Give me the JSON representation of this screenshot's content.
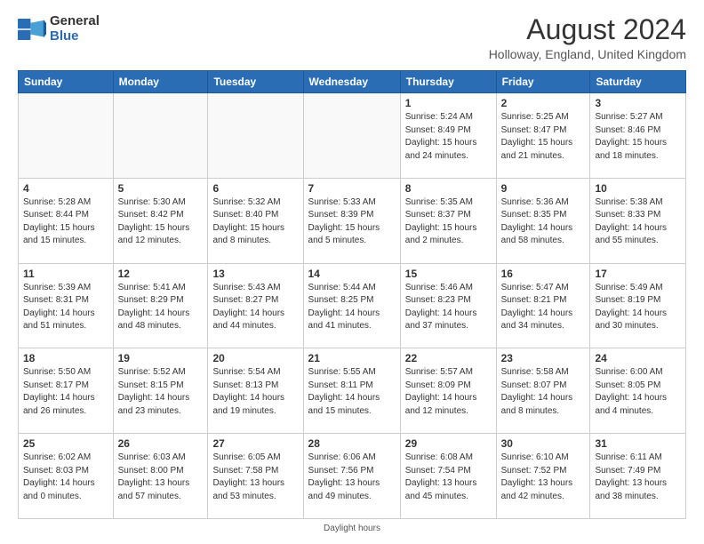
{
  "header": {
    "logo_line1": "General",
    "logo_line2": "Blue",
    "main_title": "August 2024",
    "subtitle": "Holloway, England, United Kingdom"
  },
  "calendar": {
    "columns": [
      "Sunday",
      "Monday",
      "Tuesday",
      "Wednesday",
      "Thursday",
      "Friday",
      "Saturday"
    ],
    "weeks": [
      {
        "days": [
          {
            "num": "",
            "info": ""
          },
          {
            "num": "",
            "info": ""
          },
          {
            "num": "",
            "info": ""
          },
          {
            "num": "",
            "info": ""
          },
          {
            "num": "1",
            "info": "Sunrise: 5:24 AM\nSunset: 8:49 PM\nDaylight: 15 hours\nand 24 minutes."
          },
          {
            "num": "2",
            "info": "Sunrise: 5:25 AM\nSunset: 8:47 PM\nDaylight: 15 hours\nand 21 minutes."
          },
          {
            "num": "3",
            "info": "Sunrise: 5:27 AM\nSunset: 8:46 PM\nDaylight: 15 hours\nand 18 minutes."
          }
        ]
      },
      {
        "days": [
          {
            "num": "4",
            "info": "Sunrise: 5:28 AM\nSunset: 8:44 PM\nDaylight: 15 hours\nand 15 minutes."
          },
          {
            "num": "5",
            "info": "Sunrise: 5:30 AM\nSunset: 8:42 PM\nDaylight: 15 hours\nand 12 minutes."
          },
          {
            "num": "6",
            "info": "Sunrise: 5:32 AM\nSunset: 8:40 PM\nDaylight: 15 hours\nand 8 minutes."
          },
          {
            "num": "7",
            "info": "Sunrise: 5:33 AM\nSunset: 8:39 PM\nDaylight: 15 hours\nand 5 minutes."
          },
          {
            "num": "8",
            "info": "Sunrise: 5:35 AM\nSunset: 8:37 PM\nDaylight: 15 hours\nand 2 minutes."
          },
          {
            "num": "9",
            "info": "Sunrise: 5:36 AM\nSunset: 8:35 PM\nDaylight: 14 hours\nand 58 minutes."
          },
          {
            "num": "10",
            "info": "Sunrise: 5:38 AM\nSunset: 8:33 PM\nDaylight: 14 hours\nand 55 minutes."
          }
        ]
      },
      {
        "days": [
          {
            "num": "11",
            "info": "Sunrise: 5:39 AM\nSunset: 8:31 PM\nDaylight: 14 hours\nand 51 minutes."
          },
          {
            "num": "12",
            "info": "Sunrise: 5:41 AM\nSunset: 8:29 PM\nDaylight: 14 hours\nand 48 minutes."
          },
          {
            "num": "13",
            "info": "Sunrise: 5:43 AM\nSunset: 8:27 PM\nDaylight: 14 hours\nand 44 minutes."
          },
          {
            "num": "14",
            "info": "Sunrise: 5:44 AM\nSunset: 8:25 PM\nDaylight: 14 hours\nand 41 minutes."
          },
          {
            "num": "15",
            "info": "Sunrise: 5:46 AM\nSunset: 8:23 PM\nDaylight: 14 hours\nand 37 minutes."
          },
          {
            "num": "16",
            "info": "Sunrise: 5:47 AM\nSunset: 8:21 PM\nDaylight: 14 hours\nand 34 minutes."
          },
          {
            "num": "17",
            "info": "Sunrise: 5:49 AM\nSunset: 8:19 PM\nDaylight: 14 hours\nand 30 minutes."
          }
        ]
      },
      {
        "days": [
          {
            "num": "18",
            "info": "Sunrise: 5:50 AM\nSunset: 8:17 PM\nDaylight: 14 hours\nand 26 minutes."
          },
          {
            "num": "19",
            "info": "Sunrise: 5:52 AM\nSunset: 8:15 PM\nDaylight: 14 hours\nand 23 minutes."
          },
          {
            "num": "20",
            "info": "Sunrise: 5:54 AM\nSunset: 8:13 PM\nDaylight: 14 hours\nand 19 minutes."
          },
          {
            "num": "21",
            "info": "Sunrise: 5:55 AM\nSunset: 8:11 PM\nDaylight: 14 hours\nand 15 minutes."
          },
          {
            "num": "22",
            "info": "Sunrise: 5:57 AM\nSunset: 8:09 PM\nDaylight: 14 hours\nand 12 minutes."
          },
          {
            "num": "23",
            "info": "Sunrise: 5:58 AM\nSunset: 8:07 PM\nDaylight: 14 hours\nand 8 minutes."
          },
          {
            "num": "24",
            "info": "Sunrise: 6:00 AM\nSunset: 8:05 PM\nDaylight: 14 hours\nand 4 minutes."
          }
        ]
      },
      {
        "days": [
          {
            "num": "25",
            "info": "Sunrise: 6:02 AM\nSunset: 8:03 PM\nDaylight: 14 hours\nand 0 minutes."
          },
          {
            "num": "26",
            "info": "Sunrise: 6:03 AM\nSunset: 8:00 PM\nDaylight: 13 hours\nand 57 minutes."
          },
          {
            "num": "27",
            "info": "Sunrise: 6:05 AM\nSunset: 7:58 PM\nDaylight: 13 hours\nand 53 minutes."
          },
          {
            "num": "28",
            "info": "Sunrise: 6:06 AM\nSunset: 7:56 PM\nDaylight: 13 hours\nand 49 minutes."
          },
          {
            "num": "29",
            "info": "Sunrise: 6:08 AM\nSunset: 7:54 PM\nDaylight: 13 hours\nand 45 minutes."
          },
          {
            "num": "30",
            "info": "Sunrise: 6:10 AM\nSunset: 7:52 PM\nDaylight: 13 hours\nand 42 minutes."
          },
          {
            "num": "31",
            "info": "Sunrise: 6:11 AM\nSunset: 7:49 PM\nDaylight: 13 hours\nand 38 minutes."
          }
        ]
      }
    ],
    "footer_note": "Daylight hours"
  }
}
